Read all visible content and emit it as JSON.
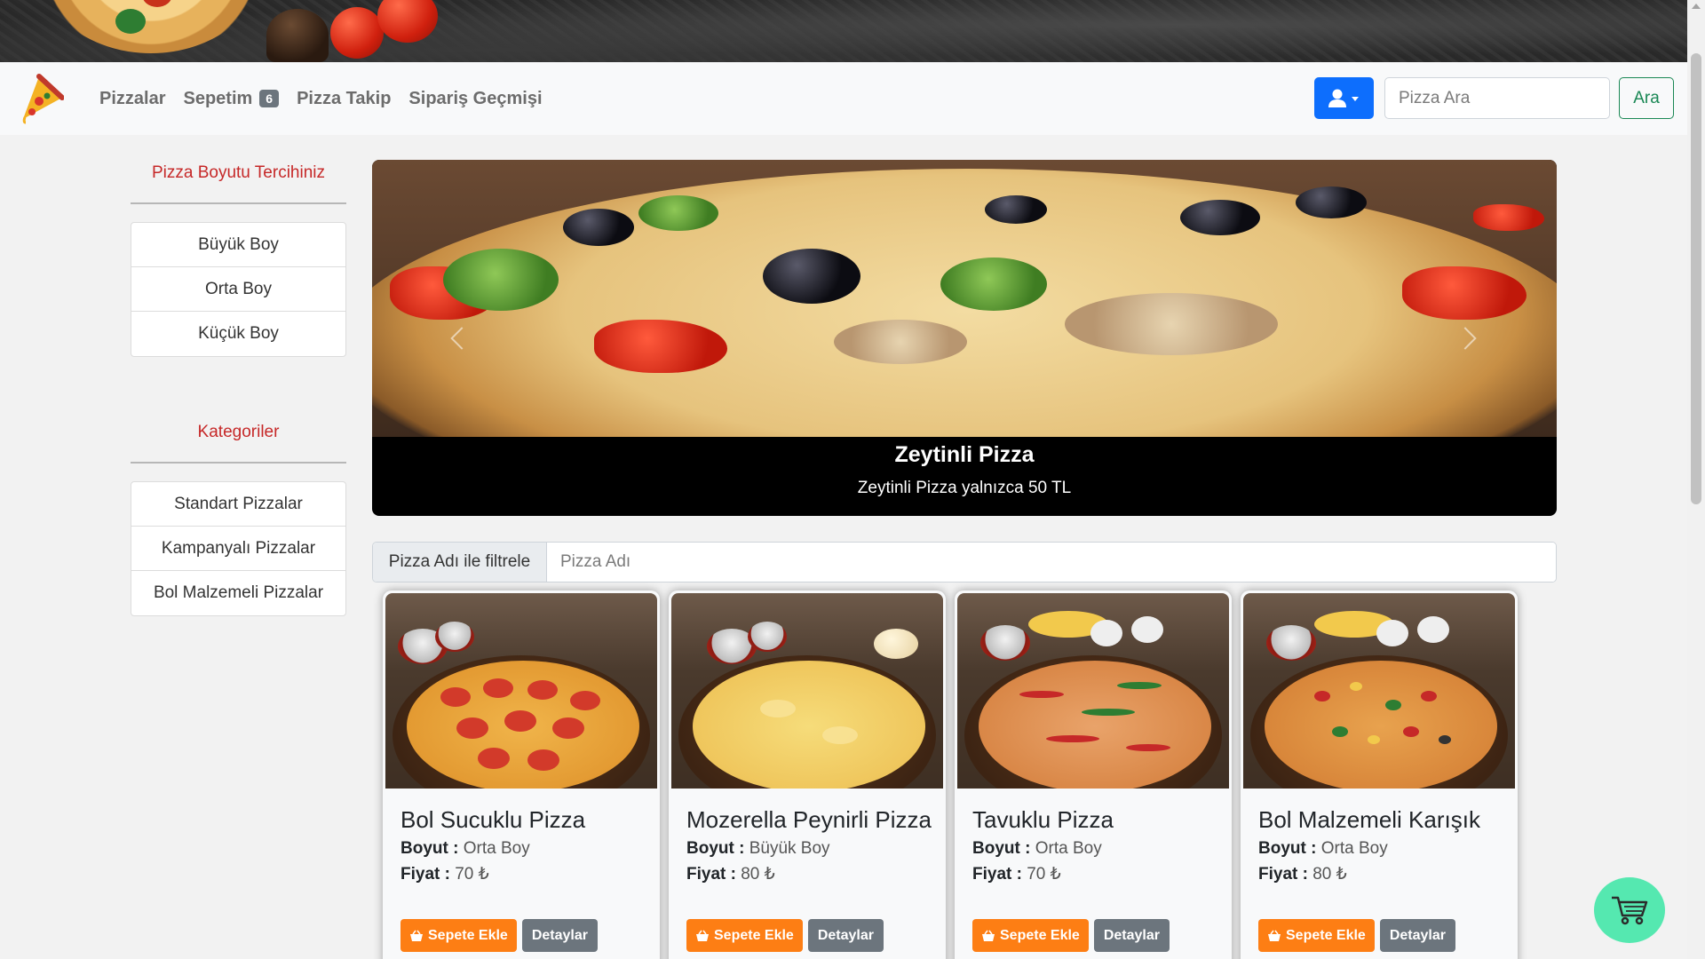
{
  "nav": {
    "links": [
      {
        "label": "Pizzalar"
      },
      {
        "label": "Sepetim",
        "badge": "6"
      },
      {
        "label": "Pizza Takip"
      },
      {
        "label": "Sipariş Geçmişi"
      }
    ],
    "search_placeholder": "Pizza Ara",
    "search_button": "Ara"
  },
  "sidebar": {
    "size_title": "Pizza Boyutu Tercihiniz",
    "sizes": [
      "Büyük Boy",
      "Orta Boy",
      "Küçük Boy"
    ],
    "category_title": "Kategoriler",
    "categories": [
      "Standart Pizzalar",
      "Kampanyalı Pizzalar",
      "Bol Malzemeli Pizzalar"
    ]
  },
  "carousel": {
    "title": "Zeytinli Pizza",
    "subtitle": "Zeytinli Pizza yalnızca 50 TL"
  },
  "filter": {
    "label": "Pizza Adı ile filtrele",
    "placeholder": "Pizza Adı"
  },
  "cards": [
    {
      "name": "Bol Sucuklu Pizza",
      "size_label": "Boyut :",
      "size": "Orta Boy",
      "price_label": "Fiyat :",
      "price": "70 ₺",
      "add": "Sepete Ekle",
      "detail": "Detaylar",
      "style": "pepperoni"
    },
    {
      "name": "Mozerella Peynirli Pizza",
      "size_label": "Boyut :",
      "size": "Büyük Boy",
      "price_label": "Fiyat :",
      "price": "80 ₺",
      "add": "Sepete Ekle",
      "detail": "Detaylar",
      "style": "cheese"
    },
    {
      "name": "Tavuklu Pizza",
      "size_label": "Boyut :",
      "size": "Orta Boy",
      "price_label": "Fiyat :",
      "price": "70 ₺",
      "add": "Sepete Ekle",
      "detail": "Detaylar",
      "style": "chicken"
    },
    {
      "name": "Bol Malzemeli Karışık",
      "size_label": "Boyut :",
      "size": "Orta Boy",
      "price_label": "Fiyat :",
      "price": "80 ₺",
      "add": "Sepete Ekle",
      "detail": "Detaylar",
      "style": "mix"
    }
  ],
  "icons": {
    "brand": "pizza-slice-icon",
    "user": "user-icon",
    "caret": "caret-down-icon",
    "basket": "basket-icon",
    "cart": "shopping-cart-icon"
  },
  "colors": {
    "primary": "#0d6efd",
    "success": "#198754",
    "accent_red": "#c62828",
    "orange": "#fd7e14",
    "secondary": "#6c757d",
    "fab": "#55e8b0"
  }
}
